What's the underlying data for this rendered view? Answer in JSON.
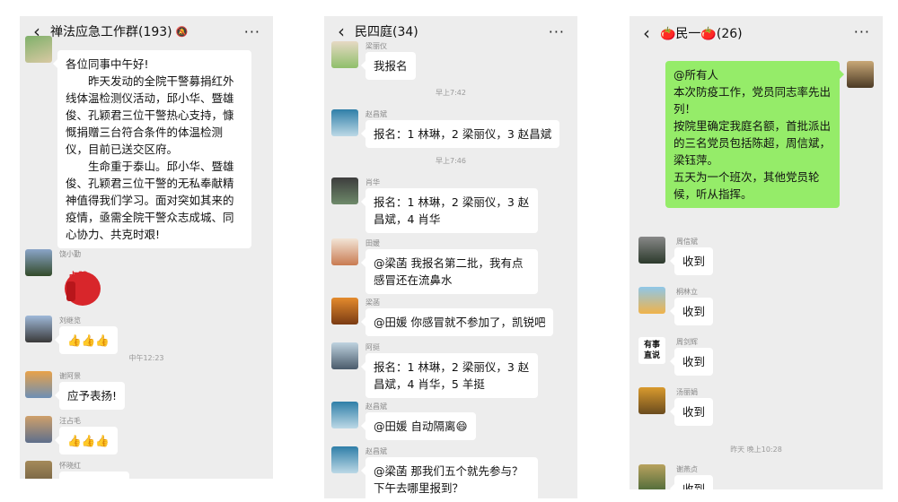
{
  "panels": [
    {
      "title": "禅法应急工作群(193)",
      "messages": [
        {
          "name": "",
          "lines": [
            "各位同事中午好!",
            "　　昨天发动的全院干警募捐红外线体温检测仪活动，邱小华、暨雄俊、孔颖君三位干警热心支持，慷慨捐赠三台符合条件的体温检测仪，目前已送交区府。",
            "　　生命重于泰山。邱小华、暨雄俊、孔颖君三位干警的无私奉献精神值得我们学习。面对突如其来的疫情，亟需全院干警众志成城、同心协力、共克时艰!"
          ]
        },
        {
          "name": "饶小勤",
          "sticker": "点赞贴图"
        },
        {
          "name": "刘继览",
          "text": "👍👍👍"
        },
        {
          "time": "中午12:23"
        },
        {
          "name": "谢阿景",
          "text": "应予表扬!"
        },
        {
          "name": "汪占毛",
          "text": "👍👍👍"
        },
        {
          "name": "怀晓红",
          "text": ""
        }
      ]
    },
    {
      "title": "民四庭(34)",
      "messages": [
        {
          "name": "梁丽仪",
          "text": "我报名"
        },
        {
          "time": "早上7:42"
        },
        {
          "name": "赵昌斌",
          "text": "报名：1 林琳，2 梁丽仪，3 赵昌斌"
        },
        {
          "time": "早上7:46"
        },
        {
          "name": "肖华",
          "text": "报名：1 林琳，2 梁丽仪，3 赵昌斌，4 肖华"
        },
        {
          "name": "田媛",
          "text": "@梁菡  我报名第二批，我有点感冒还在流鼻水"
        },
        {
          "name": "梁菡",
          "text": "@田媛  你感冒就不参加了，凯锐吧"
        },
        {
          "name": "阿挺",
          "text": "报名：1 林琳，2 梁丽仪，3 赵昌斌，4 肖华，5 羊挺"
        },
        {
          "name": "赵昌斌",
          "text": "@田媛  自动隔离😄"
        },
        {
          "name": "赵昌斌",
          "text": "@梁菡  那我们五个就先参与？下午去哪里报到？"
        }
      ]
    },
    {
      "title": "🍅民一🍅(26)",
      "messages": [
        {
          "mine": true,
          "lines": [
            "@所有人",
            "本次防疫工作，党员同志率先出列！",
            "按院里确定我庭名额，首批派出的三名党员包括陈超，周信斌，梁钰萍。",
            "五天为一个班次，其他党员轮候，听从指挥。"
          ]
        },
        {
          "name": "周信斌",
          "text": "收到"
        },
        {
          "name": "桐林立",
          "text": "收到"
        },
        {
          "name": "周剑辉",
          "text": "收到",
          "avatar_text": "有事\n直说"
        },
        {
          "name": "汤丽娟",
          "text": "收到"
        },
        {
          "time": "昨天 晚上10:28"
        },
        {
          "name": "谢燕贞",
          "text": "收到"
        }
      ]
    }
  ],
  "icons": {
    "back": "back-chevron-icon",
    "more": "more-dots-icon",
    "mute": "mute-bell-icon"
  },
  "colors": {
    "panel_bg": "#ededed",
    "bubble": "#ffffff",
    "mine_bubble": "#95ec69",
    "meta": "#888888"
  }
}
